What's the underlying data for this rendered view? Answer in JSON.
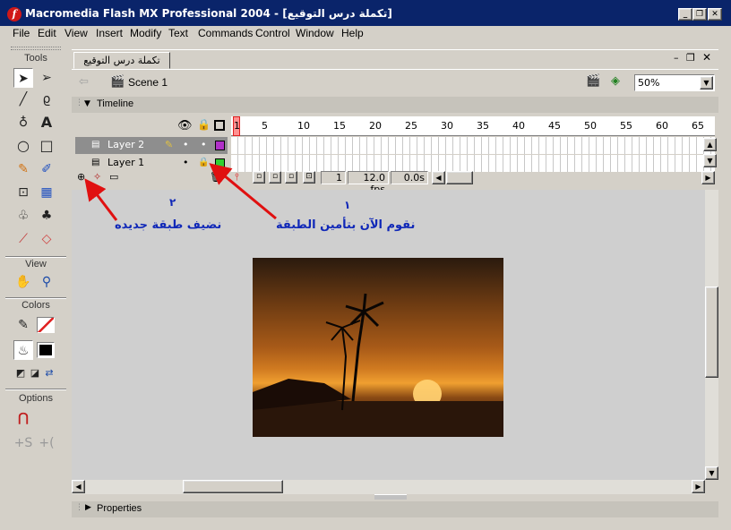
{
  "window": {
    "title": "Macromedia Flash MX Professional 2004 - [تكملة درس التوقيع]",
    "app_icon": "flash-icon",
    "controls": [
      "minimize",
      "restore",
      "close"
    ]
  },
  "menu": [
    "File",
    "Edit",
    "View",
    "Insert",
    "Modify",
    "Text",
    "Commands",
    "Control",
    "Window",
    "Help"
  ],
  "tools_panel": {
    "title": "Tools",
    "tools": [
      "arrow-tool-icon",
      "subselect-tool-icon",
      "line-tool-icon",
      "lasso-tool-icon",
      "pen-tool-icon",
      "text-tool-icon",
      "oval-tool-icon",
      "rectangle-tool-icon",
      "pencil-tool-icon",
      "brush-tool-icon",
      "free-transform-tool-icon",
      "fill-transform-tool-icon",
      "ink-bottle-tool-icon",
      "paint-bucket-tool-icon",
      "eyedropper-tool-icon",
      "eraser-tool-icon"
    ],
    "view_label": "View",
    "colors_label": "Colors",
    "options_label": "Options"
  },
  "document": {
    "tab_title": "تكملة درس التوقيع",
    "scene_name": "Scene 1",
    "zoom": "50%"
  },
  "timeline": {
    "label": "Timeline",
    "frame_numbers": [
      "1",
      "5",
      "10",
      "15",
      "20",
      "25",
      "30",
      "35",
      "40",
      "45",
      "50",
      "55",
      "60",
      "65"
    ],
    "layers": [
      {
        "name": "Layer 2",
        "color": "#b030c8",
        "selected": true,
        "locked": false
      },
      {
        "name": "Layer 1",
        "color": "#30d030",
        "selected": false,
        "locked": true
      }
    ],
    "current_frame": "1",
    "fps": "12.0 fps",
    "elapsed": "0.0s"
  },
  "annotations": {
    "left_number": "٢",
    "left_text": "نضيف طبقة جديده",
    "right_number": "١",
    "right_text": "نقوم الآن بتأمين الطبقة"
  },
  "properties_label": "Properties",
  "colors": {
    "titlebar": "#0a246a",
    "annotation_text": "#1028b8",
    "arrow": "#e01010"
  }
}
